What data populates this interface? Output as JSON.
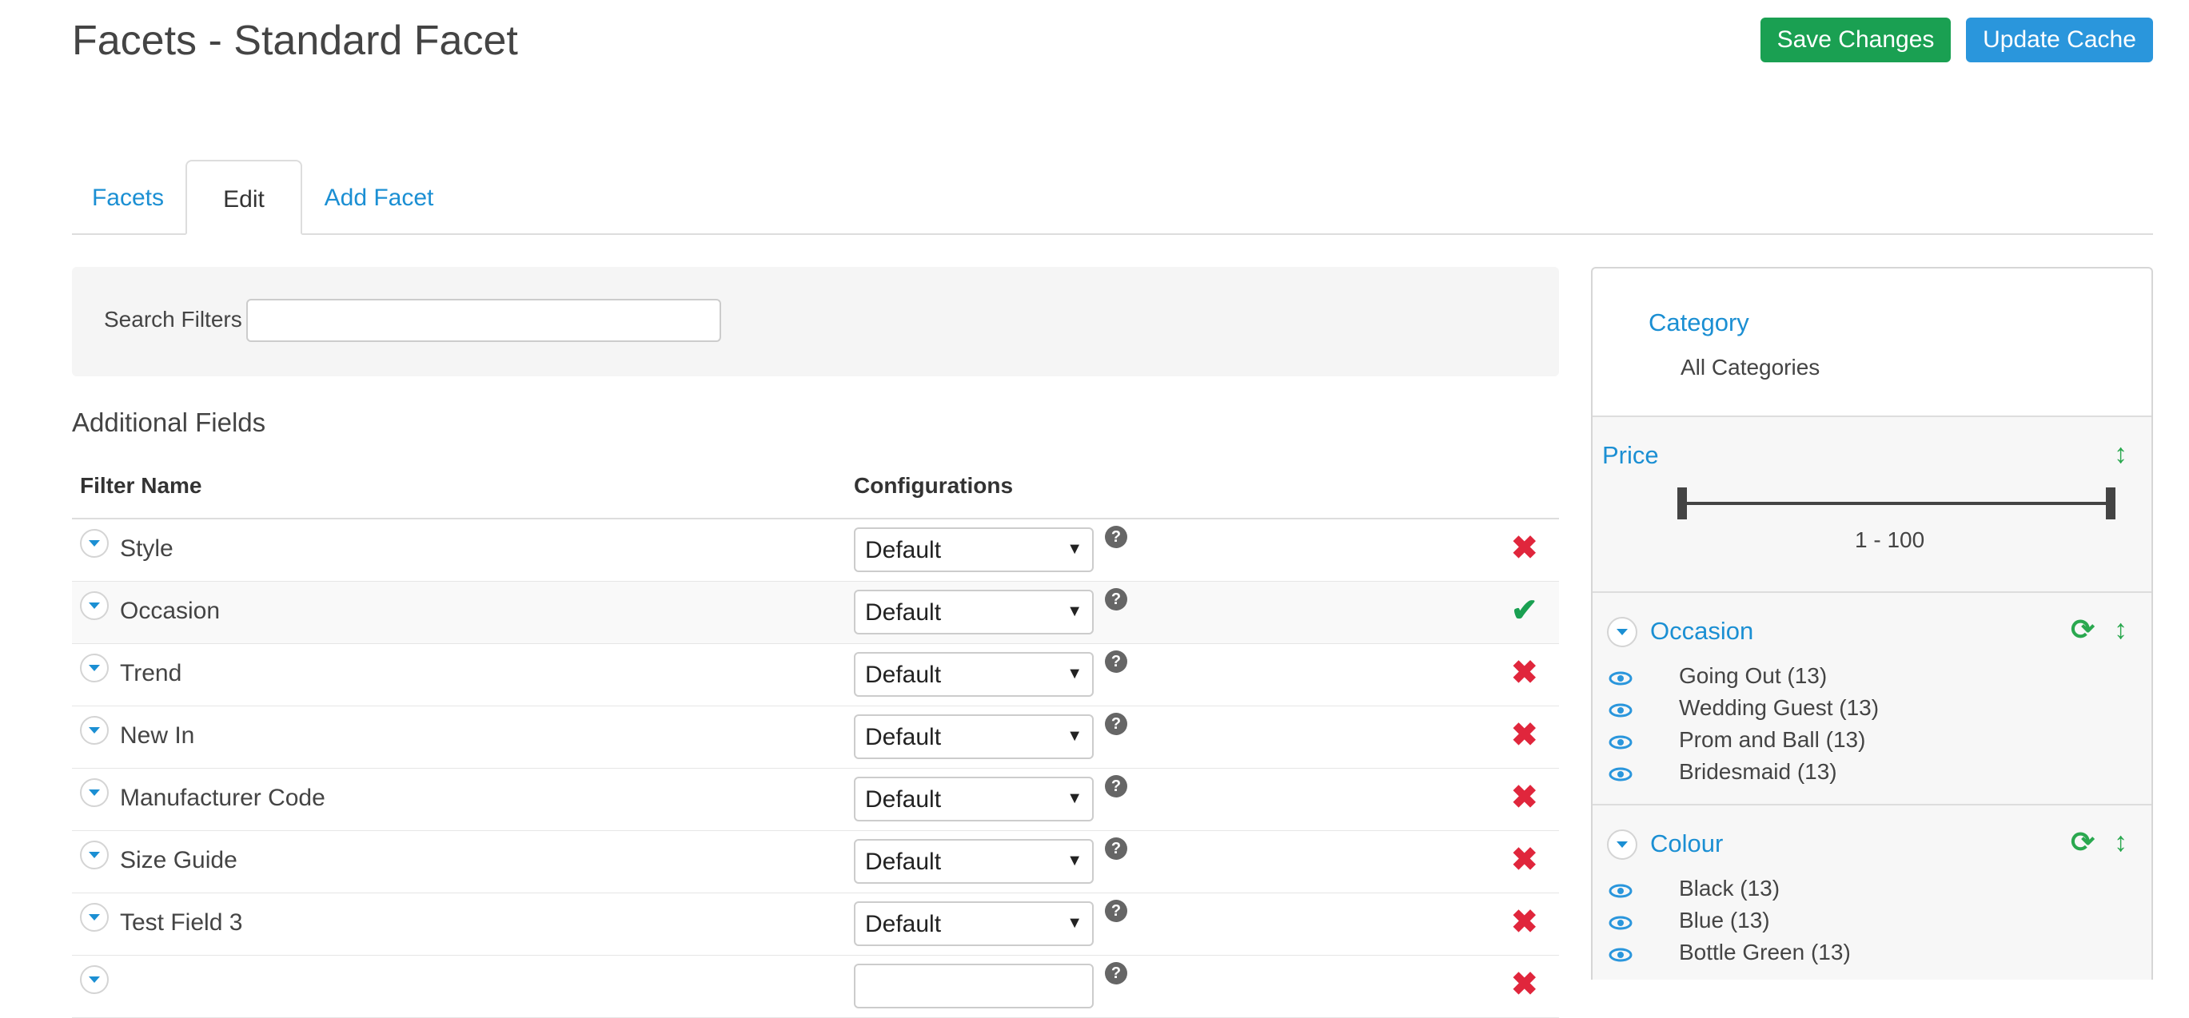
{
  "header": {
    "title": "Facets - Standard Facet",
    "save_label": "Save Changes",
    "update_label": "Update Cache",
    "save_color": "#1aa052",
    "update_color": "#2a96dc"
  },
  "tabs": [
    {
      "label": "Facets",
      "active": false
    },
    {
      "label": "Edit",
      "active": true
    },
    {
      "label": "Add Facet",
      "active": false
    }
  ],
  "search": {
    "label": "Search Filters",
    "value": "",
    "placeholder": ""
  },
  "section_title": "Additional Fields",
  "table": {
    "columns": [
      "Filter Name",
      "Configurations"
    ],
    "rows": [
      {
        "name": "Style",
        "config": "Default",
        "enabled": false
      },
      {
        "name": "Occasion",
        "config": "Default",
        "enabled": true
      },
      {
        "name": "Trend",
        "config": "Default",
        "enabled": false
      },
      {
        "name": "New In",
        "config": "Default",
        "enabled": false
      },
      {
        "name": "Manufacturer Code",
        "config": "Default",
        "enabled": false
      },
      {
        "name": "Size Guide",
        "config": "Default",
        "enabled": false
      },
      {
        "name": "Test Field 3",
        "config": "Default",
        "enabled": false
      }
    ],
    "help_symbol": "?",
    "select_arrow": "▼",
    "disabled_symbol": "✖",
    "enabled_symbol": "✔"
  },
  "preview": {
    "category": {
      "title": "Category",
      "value": "All Categories"
    },
    "price": {
      "title": "Price",
      "range": "1 - 100",
      "icon": "up-down-arrow-icon"
    },
    "occasion": {
      "title": "Occasion",
      "items": [
        "Going Out (13)",
        "Wedding Guest (13)",
        "Prom and Ball (13)",
        "Bridesmaid (13)"
      ]
    },
    "colour": {
      "title": "Colour",
      "items": [
        "Black (13)",
        "Blue (13)",
        "Bottle Green (13)"
      ]
    },
    "icons": {
      "updown": "↕",
      "refresh": "⟳"
    }
  }
}
